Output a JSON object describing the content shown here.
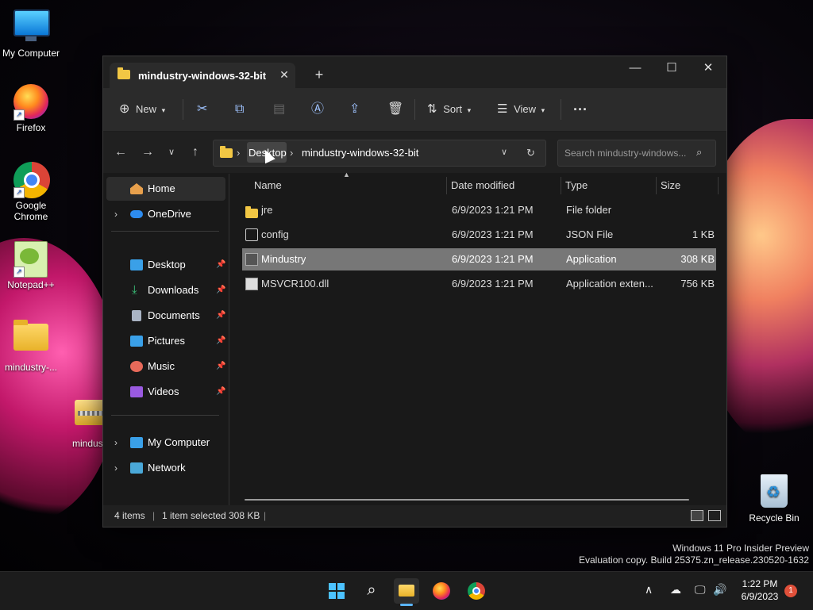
{
  "desktop": {
    "icons": [
      {
        "label": "My Computer"
      },
      {
        "label": "Firefox"
      },
      {
        "label": "Google Chrome"
      },
      {
        "label": "Notepad++"
      },
      {
        "label": "mindustry-..."
      },
      {
        "label": "mindustr"
      },
      {
        "label": "Recycle Bin"
      }
    ]
  },
  "window": {
    "tab_title": "mindustry-windows-32-bit",
    "tab_close": "✕",
    "new_tab": "+",
    "minimize": "—",
    "maximize": "☐",
    "close": "✕"
  },
  "toolbar": {
    "new_label": "New",
    "sort_label": "Sort",
    "view_label": "View",
    "more_label": "···"
  },
  "nav": {
    "breadcrumb": [
      "Desktop",
      "mindustry-windows-32-bit"
    ],
    "search_placeholder": "Search mindustry-windows..."
  },
  "sidebar": {
    "items": [
      {
        "label": "Home",
        "icon": "home-icon"
      },
      {
        "label": "OneDrive",
        "icon": "cloud-icon"
      },
      {
        "label": "Desktop",
        "icon": "desktop-icon"
      },
      {
        "label": "Downloads",
        "icon": "download-icon"
      },
      {
        "label": "Documents",
        "icon": "documents-icon"
      },
      {
        "label": "Pictures",
        "icon": "pictures-icon"
      },
      {
        "label": "Music",
        "icon": "music-icon"
      },
      {
        "label": "Videos",
        "icon": "videos-icon"
      },
      {
        "label": "My Computer",
        "icon": "computer-icon"
      },
      {
        "label": "Network",
        "icon": "network-icon"
      }
    ]
  },
  "files": {
    "columns": [
      "Name",
      "Date modified",
      "Type",
      "Size"
    ],
    "rows": [
      {
        "name": "jre",
        "date": "6/9/2023 1:21 PM",
        "type": "File folder",
        "size": ""
      },
      {
        "name": "config",
        "date": "6/9/2023 1:21 PM",
        "type": "JSON File",
        "size": "1 KB"
      },
      {
        "name": "Mindustry",
        "date": "6/9/2023 1:21 PM",
        "type": "Application",
        "size": "308 KB"
      },
      {
        "name": "MSVCR100.dll",
        "date": "6/9/2023 1:21 PM",
        "type": "Application exten...",
        "size": "756 KB"
      }
    ]
  },
  "status": {
    "items_count": "4 items",
    "selected": "1 item selected",
    "selected_size": "308 KB"
  },
  "watermark": {
    "line1": "Windows 11 Pro Insider Preview",
    "line2": "Evaluation copy. Build 25375.zn_release.230520-1632"
  },
  "taskbar": {
    "time": "1:22 PM",
    "date": "6/9/2023",
    "notifications": "1"
  },
  "colors": {
    "accent": "#4cc2ff",
    "selected_row": "#777777",
    "window_bg": "#191919"
  }
}
